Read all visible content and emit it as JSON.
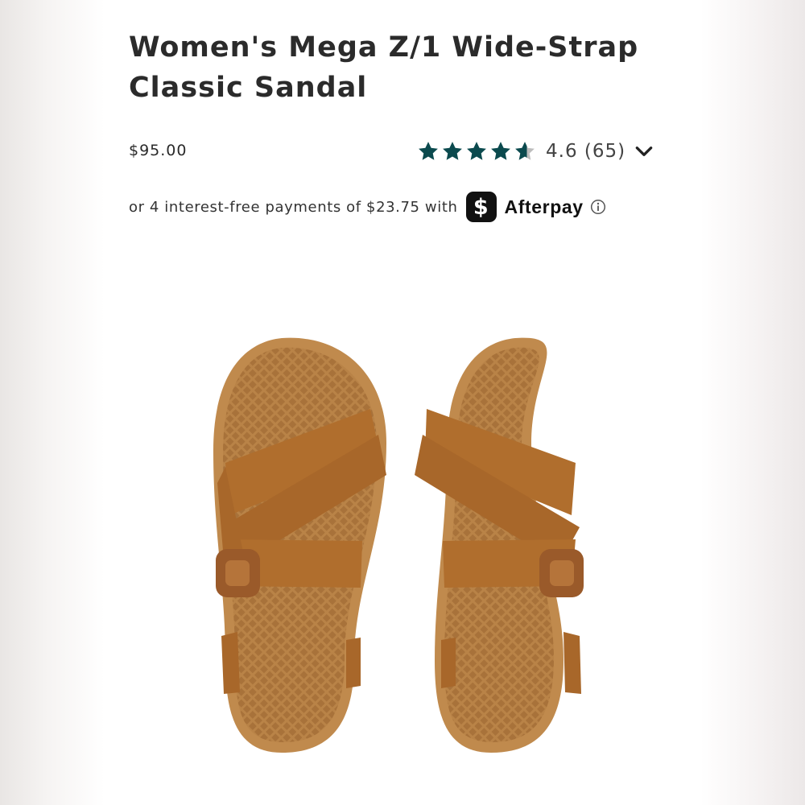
{
  "product": {
    "title": "Women's Mega Z/1 Wide-Strap Classic Sandal",
    "price": "$95.00",
    "image_alt": "Women's Mega Z/1 Wide-Strap Classic Sandal"
  },
  "rating": {
    "value": 4.6,
    "score_text": "4.6",
    "count_text": "(65)",
    "star_color": "#0b4a4e",
    "empty_star_color": "#bdbdbd",
    "toggle_icon": "chevron-down-icon"
  },
  "afterpay": {
    "text": "or 4 interest-free payments of $23.75 with",
    "logo_glyph": "$",
    "brand": "Afterpay",
    "info_icon": "info-icon"
  },
  "colors": {
    "strap": "#b06e2d",
    "sole": "#b98347",
    "buckle": "#9a5a2a"
  }
}
